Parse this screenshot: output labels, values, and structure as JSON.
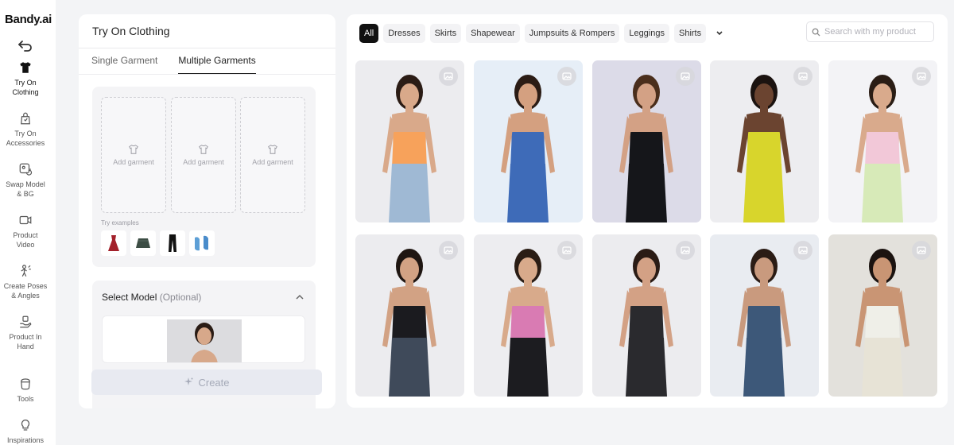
{
  "app": {
    "logo": "Bandy.ai"
  },
  "sidebar": {
    "items": [
      {
        "label": "Try On\nClothing",
        "icon": "tshirt-icon",
        "active": true
      },
      {
        "label": "Try On\nAccessories",
        "icon": "bag-icon"
      },
      {
        "label": "Swap Model\n& BG",
        "icon": "swap-icon"
      },
      {
        "label": "Product\nVideo",
        "icon": "video-icon"
      },
      {
        "label": "Create Poses\n& Angles",
        "icon": "pose-icon"
      },
      {
        "label": "Product In\nHand",
        "icon": "hand-icon"
      },
      {
        "label": "Tools",
        "icon": "tools-icon"
      },
      {
        "label": "Inspirations",
        "icon": "bulb-icon"
      }
    ]
  },
  "panel": {
    "title": "Try On Clothing",
    "tabs": [
      {
        "label": "Single Garment",
        "active": false
      },
      {
        "label": "Multiple Garments",
        "active": true
      }
    ],
    "slots": [
      "Add garment",
      "Add garment",
      "Add garment"
    ],
    "try_examples_label": "Try examples",
    "examples": [
      "red-dress-icon",
      "green-skirt-icon",
      "black-pants-icon",
      "blue-sneakers-icon"
    ],
    "model": {
      "title": "Select Model",
      "optional": "(Optional)"
    },
    "create_label": "Create"
  },
  "gallery": {
    "filters": [
      {
        "label": "All",
        "active": true
      },
      {
        "label": "Dresses"
      },
      {
        "label": "Skirts"
      },
      {
        "label": "Shapewear"
      },
      {
        "label": "Jumpsuits & Rompers"
      },
      {
        "label": "Leggings"
      },
      {
        "label": "Shirts"
      }
    ],
    "search_placeholder": "Search with my product",
    "cards": [
      {
        "name": "orange-tube-top-jeans",
        "bg": "#ececef",
        "top": "#f7a25b",
        "bottom": "#9fb9d4",
        "skin": "#d9a98a",
        "hair": "#2b1c15"
      },
      {
        "name": "blue-floral-mini-dress",
        "bg": "#e6eef7",
        "top": "#3e6bb8",
        "bottom": "#3e6bb8",
        "skin": "#d4a080",
        "hair": "#2b1c15"
      },
      {
        "name": "black-halter-dress",
        "bg": "#dcdbe8",
        "top": "#15161a",
        "bottom": "#15161a",
        "skin": "#d3a185",
        "hair": "#4a2e1c"
      },
      {
        "name": "yellow-cutout-jumpsuit",
        "bg": "#ededf0",
        "top": "#d8d52c",
        "bottom": "#d8d52c",
        "skin": "#6b4430",
        "hair": "#1b1310"
      },
      {
        "name": "pastel-floral-girl-dress",
        "bg": "#f3f3f6",
        "top": "#f2c8d8",
        "bottom": "#d7eab8",
        "skin": "#d9aa8c",
        "hair": "#2a1d15"
      },
      {
        "name": "black-top-denim-shorts",
        "bg": "#ececef",
        "top": "#1b1b1f",
        "bottom": "#3f4a5a",
        "skin": "#d2a284",
        "hair": "#1f1612"
      },
      {
        "name": "pink-top-leather-skirt",
        "bg": "#ededf0",
        "top": "#d97bb3",
        "bottom": "#1c1c20",
        "skin": "#d8aa8b",
        "hair": "#2a1d15"
      },
      {
        "name": "striped-fringe-dress",
        "bg": "#ececef",
        "top": "#2a2a2e",
        "bottom": "#2a2a2e",
        "skin": "#d3a185",
        "hair": "#2b1c15"
      },
      {
        "name": "navy-hoodie",
        "bg": "#e9ecf1",
        "top": "#3d5879",
        "bottom": "#3d5879",
        "skin": "#c99a7e",
        "hair": "#2b1c15"
      },
      {
        "name": "white-polo-shorts",
        "bg": "#e3e1dc",
        "top": "#efefe8",
        "bottom": "#e7e3d6",
        "skin": "#c99574",
        "hair": "#1b1310"
      }
    ]
  }
}
